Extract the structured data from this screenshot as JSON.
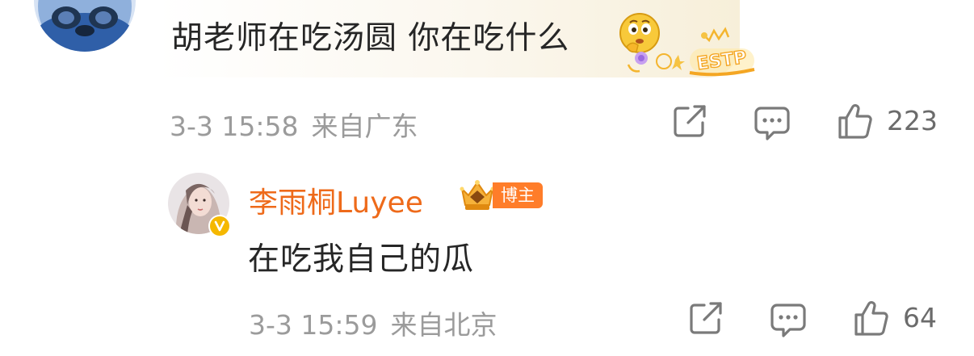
{
  "top_comment": {
    "text": "胡老师在吃汤圆 你在吃什么",
    "emoji_icon": "thinking-face-icon",
    "decoration_text": "ESTP",
    "date": "3-3 15:58",
    "location": "来自广东",
    "like_count": "223"
  },
  "reply": {
    "author": "李雨桐Luyee",
    "badge": "博主",
    "badge_color": "#ff7d2a",
    "name_color": "#ee6a1a",
    "text": "在吃我自己的瓜",
    "date": "3-3 15:59",
    "location": "来自北京",
    "like_count": "64"
  },
  "colors": {
    "text_primary": "#262626",
    "text_meta": "#9b9b9b",
    "verified": "#f5b800"
  }
}
